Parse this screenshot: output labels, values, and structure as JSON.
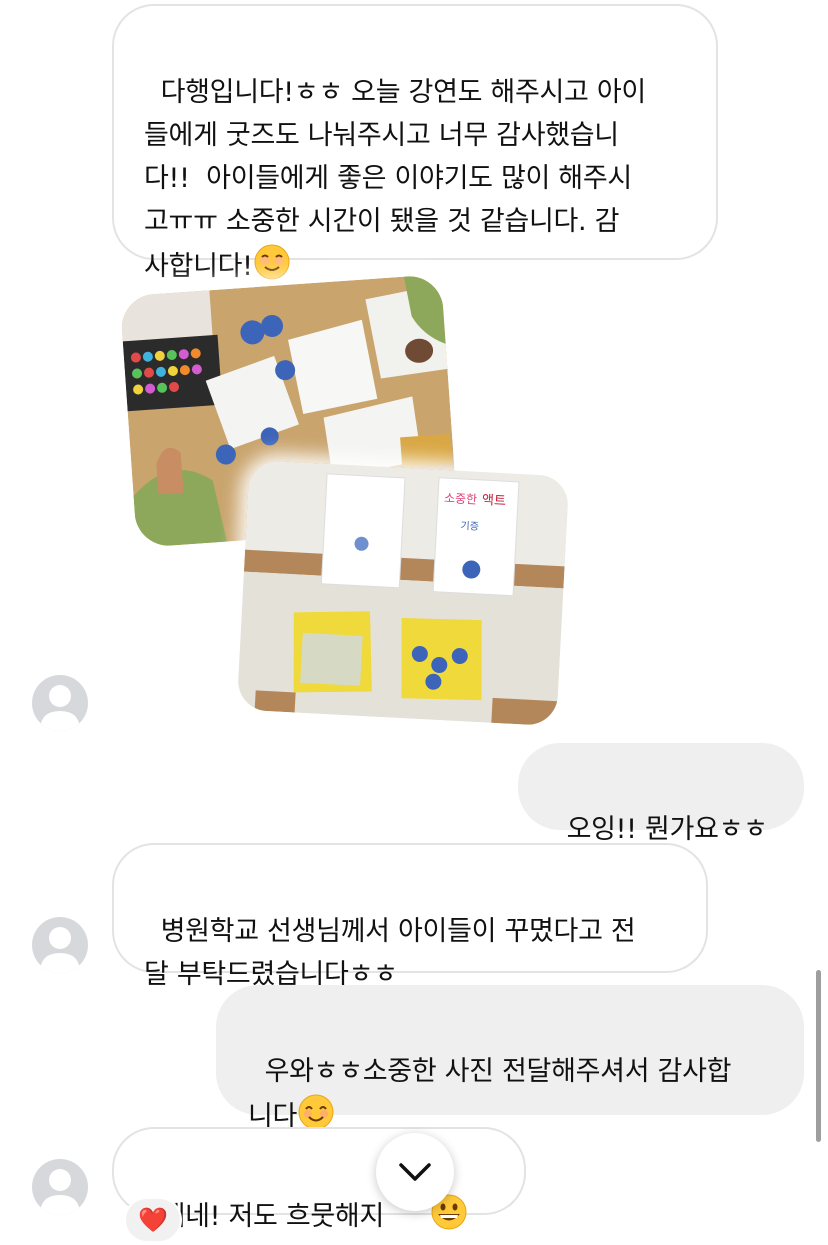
{
  "messages": [
    {
      "direction": "incoming",
      "text": "다행입니다!ㅎㅎ 오늘 강연도 해주시고 아이\n들에게 굿즈도 나눠주시고 너무 감사했습니\n다!!  아이들에게 좋은 이야기도 많이 해주시\n고ㅠㅠ 소중한 시간이 됐을 것 같습니다. 감\n사합니다!",
      "emoji": "smiling-face"
    },
    {
      "direction": "incoming",
      "type": "photos",
      "photos": [
        "kids-decorating-desk-photo",
        "decorated-papers-wall-photo"
      ]
    },
    {
      "direction": "outgoing",
      "text": "오잉!! 뭔가요ㅎㅎ"
    },
    {
      "direction": "incoming",
      "text": "병원학교 선생님께서 아이들이 꾸몄다고 전\n달 부탁드렸습니다ㅎㅎ"
    },
    {
      "direction": "outgoing",
      "text": "우와ㅎㅎ소중한 사진 전달해주셔서 감사합\n니다",
      "emoji": "smiling-face-with-smiling-eyes"
    },
    {
      "direction": "incoming",
      "text": "네네! 저도 흐뭇해지",
      "emoji": "grinning-face",
      "reaction": "❤️"
    }
  ],
  "icons": {
    "avatar": "default-user-avatar-icon",
    "scroll_down": "chevron-down-icon",
    "reaction": "heart-icon"
  },
  "colors": {
    "incoming_bubble_border": "#e3e3e3",
    "outgoing_bubble_bg": "#efefef",
    "avatar_bg": "#d7d8dc",
    "heart": "#e0162b"
  }
}
